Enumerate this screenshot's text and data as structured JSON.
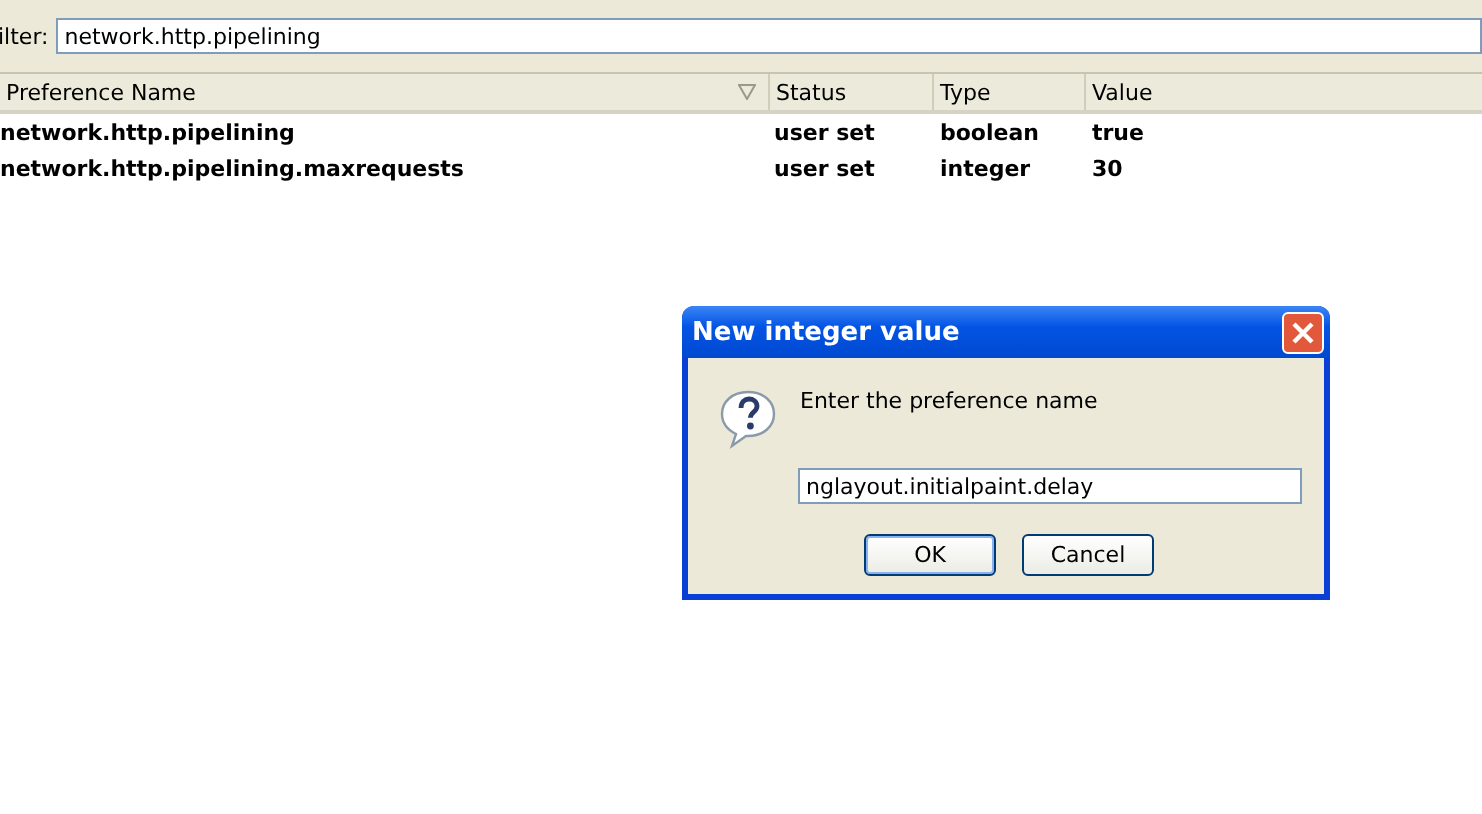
{
  "filter": {
    "label": "ilter:",
    "value": "network.http.pipelining"
  },
  "table": {
    "columns": [
      {
        "label": "Preference Name",
        "sorted": true
      },
      {
        "label": "Status",
        "sorted": false
      },
      {
        "label": "Type",
        "sorted": false
      },
      {
        "label": "Value",
        "sorted": false
      }
    ],
    "rows": [
      [
        "network.http.pipelining",
        "user set",
        "boolean",
        "true"
      ],
      [
        "network.http.pipelining.maxrequests",
        "user set",
        "integer",
        "30"
      ]
    ]
  },
  "dialog": {
    "title": "New integer value",
    "message": "Enter the preference name",
    "value": "nglayout.initialpaint.delay",
    "buttons": [
      {
        "label": "OK",
        "default": true
      },
      {
        "label": "Cancel",
        "default": false
      }
    ]
  }
}
